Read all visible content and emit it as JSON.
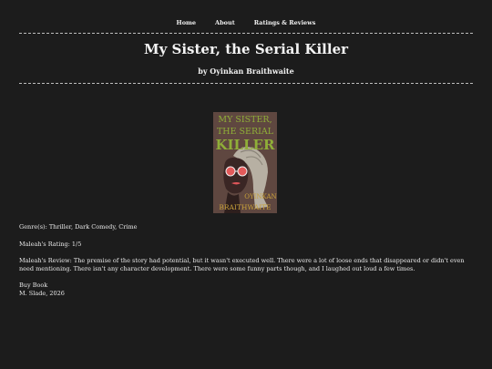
{
  "nav": {
    "home": "Home",
    "about": "About",
    "ratings": "Ratings & Reviews"
  },
  "book": {
    "title": "My Sister, the Serial Killer",
    "author": "by Oyinkan Braithwaite",
    "cover_text": {
      "line1": "MY SISTER,",
      "line2": "THE SERIAL",
      "line3": "KILLER",
      "author1": "OYINKAN",
      "author2": "BRAITHWAITE"
    },
    "colors": {
      "cover_bg": "#6b4f45",
      "cover_title": "#8fae38",
      "cover_author": "#c9a23a"
    }
  },
  "details": {
    "genre": "Genre(s): Thriller, Dark Comedy, Crime",
    "rating": "Maleah's Rating: 1/5",
    "review": "Maleah's Review: The premise of the story had potential, but it wasn't executed well. There were a lot of loose ends that disappeared or didn't even need mentioning. There isn't any character development. There were some funny parts though, and I laughed out loud a few times.",
    "buy_link": "Buy Book",
    "footer": "M. Slade, 2026"
  }
}
